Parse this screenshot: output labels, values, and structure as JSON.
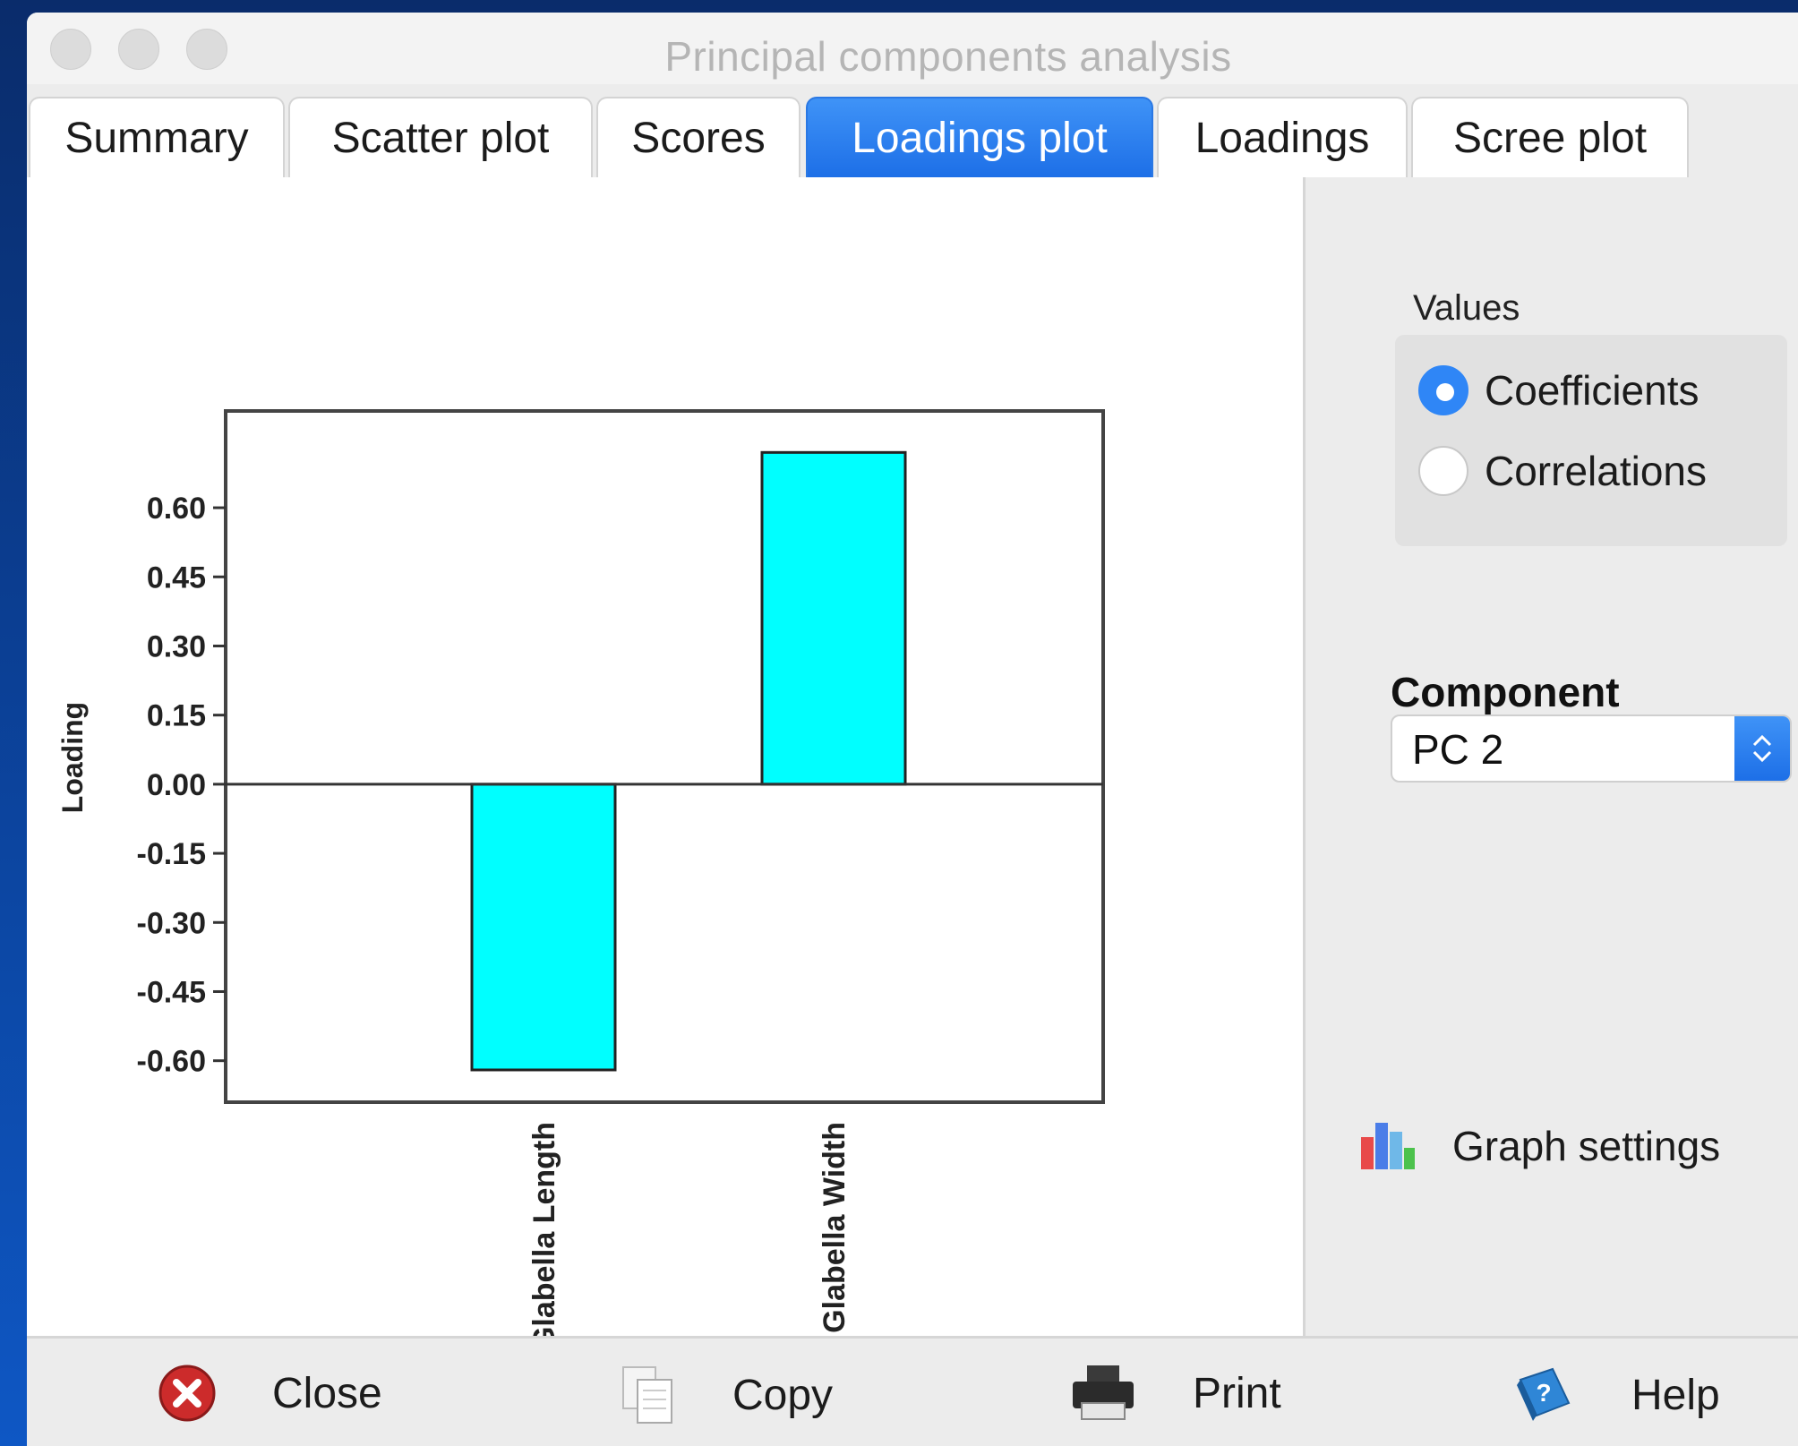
{
  "window": {
    "title": "Principal components analysis"
  },
  "tabs": [
    {
      "label": "Summary",
      "active": false
    },
    {
      "label": "Scatter plot",
      "active": false
    },
    {
      "label": "Scores",
      "active": false
    },
    {
      "label": "Loadings plot",
      "active": true
    },
    {
      "label": "Loadings",
      "active": false
    },
    {
      "label": "Scree plot",
      "active": false
    }
  ],
  "panel": {
    "values_label": "Values",
    "options": [
      {
        "label": "Coefficients",
        "checked": true
      },
      {
        "label": "Correlations",
        "checked": false
      }
    ],
    "component_label": "Component",
    "component_value": "PC 2",
    "graph_settings_label": "Graph settings"
  },
  "buttons": {
    "close": "Close",
    "copy": "Copy",
    "print": "Print",
    "help": "Help"
  },
  "colors": {
    "accent": "#1d6fe7",
    "bar_fill": "#00ffff"
  },
  "chart_data": {
    "type": "bar",
    "categories": [
      "Glabella Length",
      "Glabella Width"
    ],
    "values": [
      -0.62,
      0.72
    ],
    "ylabel": "Loading",
    "ylim": [
      -0.69,
      0.81
    ],
    "yticks": [
      "0.60",
      "0.45",
      "0.30",
      "0.15",
      "0.00",
      "-0.15",
      "-0.30",
      "-0.45",
      "-0.60"
    ],
    "ytick_values": [
      0.6,
      0.45,
      0.3,
      0.15,
      0.0,
      -0.15,
      -0.3,
      -0.45,
      -0.6
    ]
  }
}
